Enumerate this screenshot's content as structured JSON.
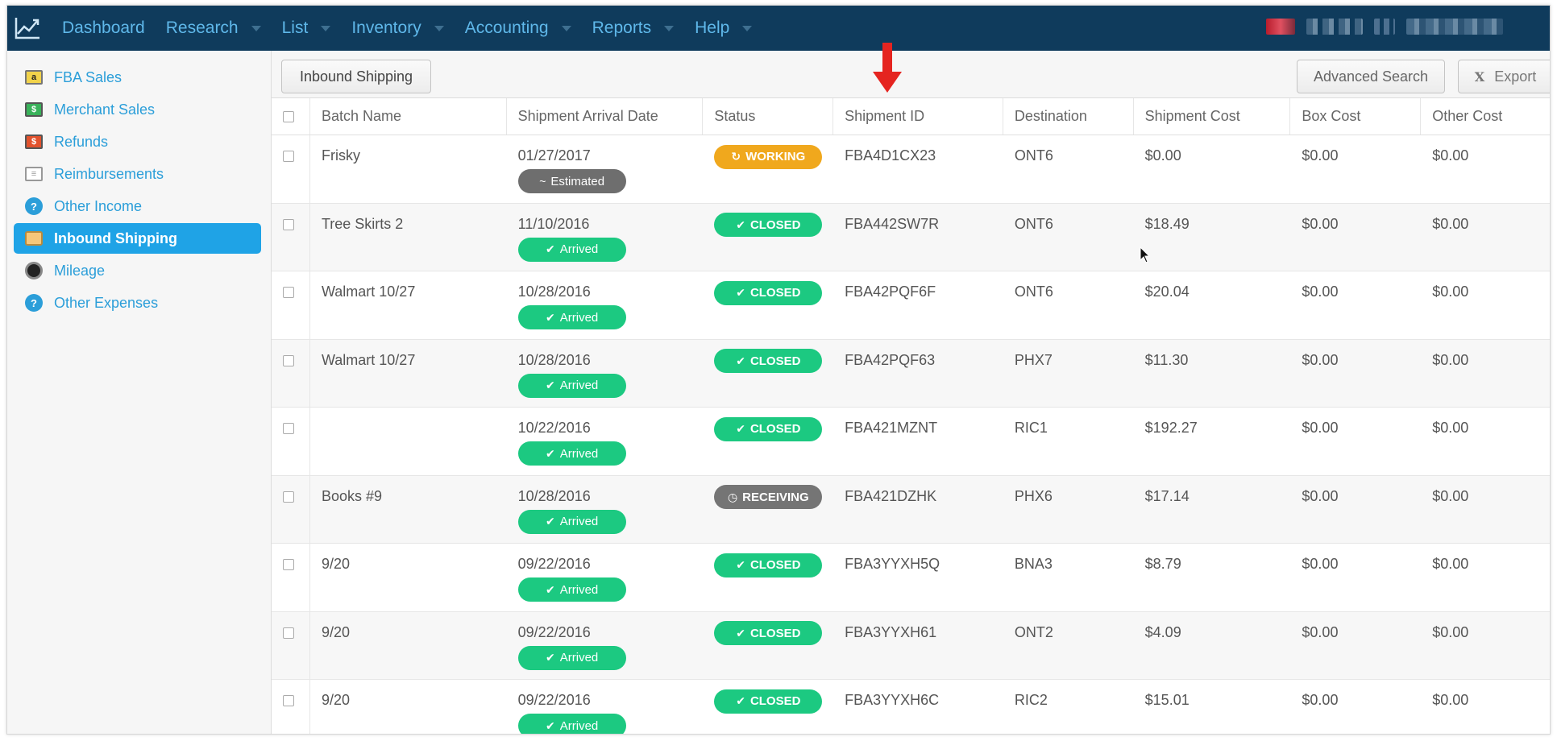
{
  "nav": {
    "items": [
      {
        "label": "Dashboard",
        "caret": false
      },
      {
        "label": "Research",
        "caret": true
      },
      {
        "label": "List",
        "caret": true
      },
      {
        "label": "Inventory",
        "caret": true
      },
      {
        "label": "Accounting",
        "caret": true
      },
      {
        "label": "Reports",
        "caret": true
      },
      {
        "label": "Help",
        "caret": true
      }
    ]
  },
  "sidebar": {
    "items": [
      {
        "label": "FBA Sales",
        "icon": "amazon-box-icon",
        "active": false
      },
      {
        "label": "Merchant Sales",
        "icon": "money-icon",
        "active": false
      },
      {
        "label": "Refunds",
        "icon": "refund-icon",
        "active": false
      },
      {
        "label": "Reimbursements",
        "icon": "document-icon",
        "active": false
      },
      {
        "label": "Other Income",
        "icon": "question-icon",
        "active": false
      },
      {
        "label": "Inbound Shipping",
        "icon": "package-icon",
        "active": true
      },
      {
        "label": "Mileage",
        "icon": "speedometer-icon",
        "active": false
      },
      {
        "label": "Other Expenses",
        "icon": "question-icon",
        "active": false
      }
    ]
  },
  "toolbar": {
    "inbound_label": "Inbound Shipping",
    "advanced_search_label": "Advanced Search",
    "export_label": "Export",
    "export_icon": "X"
  },
  "table": {
    "columns": [
      "Batch Name",
      "Shipment Arrival Date",
      "Status",
      "Shipment ID",
      "Destination",
      "Shipment Cost",
      "Box Cost",
      "Other Cost"
    ],
    "rows": [
      {
        "batch": "Frisky",
        "date": "01/27/2017",
        "arrival": "Estimated",
        "status": "WORKING",
        "shipment_id": "FBA4D1CX23",
        "destination": "ONT6",
        "shipment_cost": "$0.00",
        "box_cost": "$0.00",
        "other_cost": "$0.00"
      },
      {
        "batch": "Tree Skirts 2",
        "date": "11/10/2016",
        "arrival": "Arrived",
        "status": "CLOSED",
        "shipment_id": "FBA442SW7R",
        "destination": "ONT6",
        "shipment_cost": "$18.49",
        "box_cost": "$0.00",
        "other_cost": "$0.00"
      },
      {
        "batch": "Walmart 10/27",
        "date": "10/28/2016",
        "arrival": "Arrived",
        "status": "CLOSED",
        "shipment_id": "FBA42PQF6F",
        "destination": "ONT6",
        "shipment_cost": "$20.04",
        "box_cost": "$0.00",
        "other_cost": "$0.00"
      },
      {
        "batch": "Walmart 10/27",
        "date": "10/28/2016",
        "arrival": "Arrived",
        "status": "CLOSED",
        "shipment_id": "FBA42PQF63",
        "destination": "PHX7",
        "shipment_cost": "$11.30",
        "box_cost": "$0.00",
        "other_cost": "$0.00"
      },
      {
        "batch": "",
        "date": "10/22/2016",
        "arrival": "Arrived",
        "status": "CLOSED",
        "shipment_id": "FBA421MZNT",
        "destination": "RIC1",
        "shipment_cost": "$192.27",
        "box_cost": "$0.00",
        "other_cost": "$0.00"
      },
      {
        "batch": "Books #9",
        "date": "10/28/2016",
        "arrival": "Arrived",
        "status": "RECEIVING",
        "shipment_id": "FBA421DZHK",
        "destination": "PHX6",
        "shipment_cost": "$17.14",
        "box_cost": "$0.00",
        "other_cost": "$0.00"
      },
      {
        "batch": "9/20",
        "date": "09/22/2016",
        "arrival": "Arrived",
        "status": "CLOSED",
        "shipment_id": "FBA3YYXH5Q",
        "destination": "BNA3",
        "shipment_cost": "$8.79",
        "box_cost": "$0.00",
        "other_cost": "$0.00"
      },
      {
        "batch": "9/20",
        "date": "09/22/2016",
        "arrival": "Arrived",
        "status": "CLOSED",
        "shipment_id": "FBA3YYXH61",
        "destination": "ONT2",
        "shipment_cost": "$4.09",
        "box_cost": "$0.00",
        "other_cost": "$0.00"
      },
      {
        "batch": "9/20",
        "date": "09/22/2016",
        "arrival": "Arrived",
        "status": "CLOSED",
        "shipment_id": "FBA3YYXH6C",
        "destination": "RIC2",
        "shipment_cost": "$15.01",
        "box_cost": "$0.00",
        "other_cost": "$0.00"
      }
    ]
  },
  "colors": {
    "nav_bg": "#0f3b5c",
    "nav_link": "#5fb8ea",
    "accent": "#1fa3e6",
    "closed": "#1cc981",
    "working": "#f0a81d",
    "receiving": "#757575",
    "annotation_arrow": "#e52420"
  }
}
